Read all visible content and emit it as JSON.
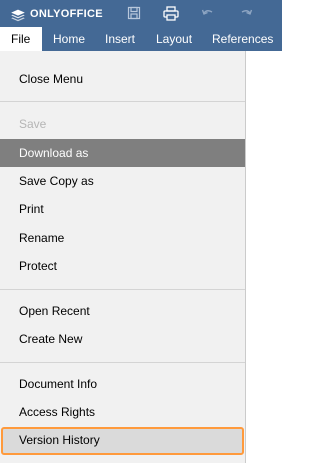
{
  "app": {
    "brand": "ONLYOFFICE"
  },
  "toolbar": {
    "buttons": [
      {
        "icon": "save-icon"
      },
      {
        "icon": "print-icon"
      },
      {
        "icon": "undo-icon"
      },
      {
        "icon": "redo-icon"
      }
    ]
  },
  "tabs": [
    "File",
    "Home",
    "Insert",
    "Layout",
    "References"
  ],
  "active_tab": "File",
  "file_menu": {
    "close": "Close Menu",
    "save": "Save",
    "download_as": "Download as",
    "save_copy_as": "Save Copy as",
    "print": "Print",
    "rename": "Rename",
    "protect": "Protect",
    "open_recent": "Open Recent",
    "create_new": "Create New",
    "document_info": "Document Info",
    "access_rights": "Access Rights",
    "version_history": "Version History"
  },
  "colors": {
    "header_bg": "#446995",
    "menu_bg": "#f1f1f1",
    "selected_item_bg": "#7f7f7f",
    "highlight_border": "#ff9a3c"
  }
}
